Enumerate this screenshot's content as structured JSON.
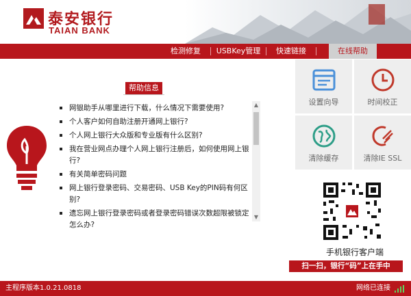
{
  "brand": {
    "name_cn": "泰安银行",
    "name_en": "TAIAN BANK"
  },
  "nav": {
    "items": [
      "检测修复",
      "USBKey管理",
      "快速链接",
      "在线帮助"
    ],
    "active_index": 3
  },
  "help": {
    "title": "帮助信息",
    "items": [
      "网银助手从哪里进行下载，什么情况下需要使用?",
      "个人客户如何自助注册开通网上银行?",
      "个人网上银行大众版和专业版有什么区别?",
      "我在营业网点办理个人网上银行注册后，如何使用网上银行?",
      "有关简单密码问题",
      "网上银行登录密码、交易密码、USB Key的PIN码有何区别?",
      "遗忘网上银行登录密码或者登录密码错误次数超限被锁定怎么办?"
    ]
  },
  "tools": [
    {
      "label": "设置向导",
      "icon": "setup-wizard-icon",
      "color": "#4a90d9"
    },
    {
      "label": "时间校正",
      "icon": "clock-icon",
      "color": "#c0392b"
    },
    {
      "label": "清除缓存",
      "icon": "globe-icon",
      "color": "#2e9e88"
    },
    {
      "label": "清除IE SSL",
      "icon": "clean-ssl-icon",
      "color": "#c0392b"
    }
  ],
  "mobile": {
    "caption": "手机银行客户端",
    "slogan": "扫一扫，银行“码”上在手中"
  },
  "status": {
    "version": "主程序版本1.0.21.0818",
    "network": "网络已连接"
  },
  "colors": {
    "brand_red": "#b8161c",
    "tile_bg": "#eeeeee"
  }
}
